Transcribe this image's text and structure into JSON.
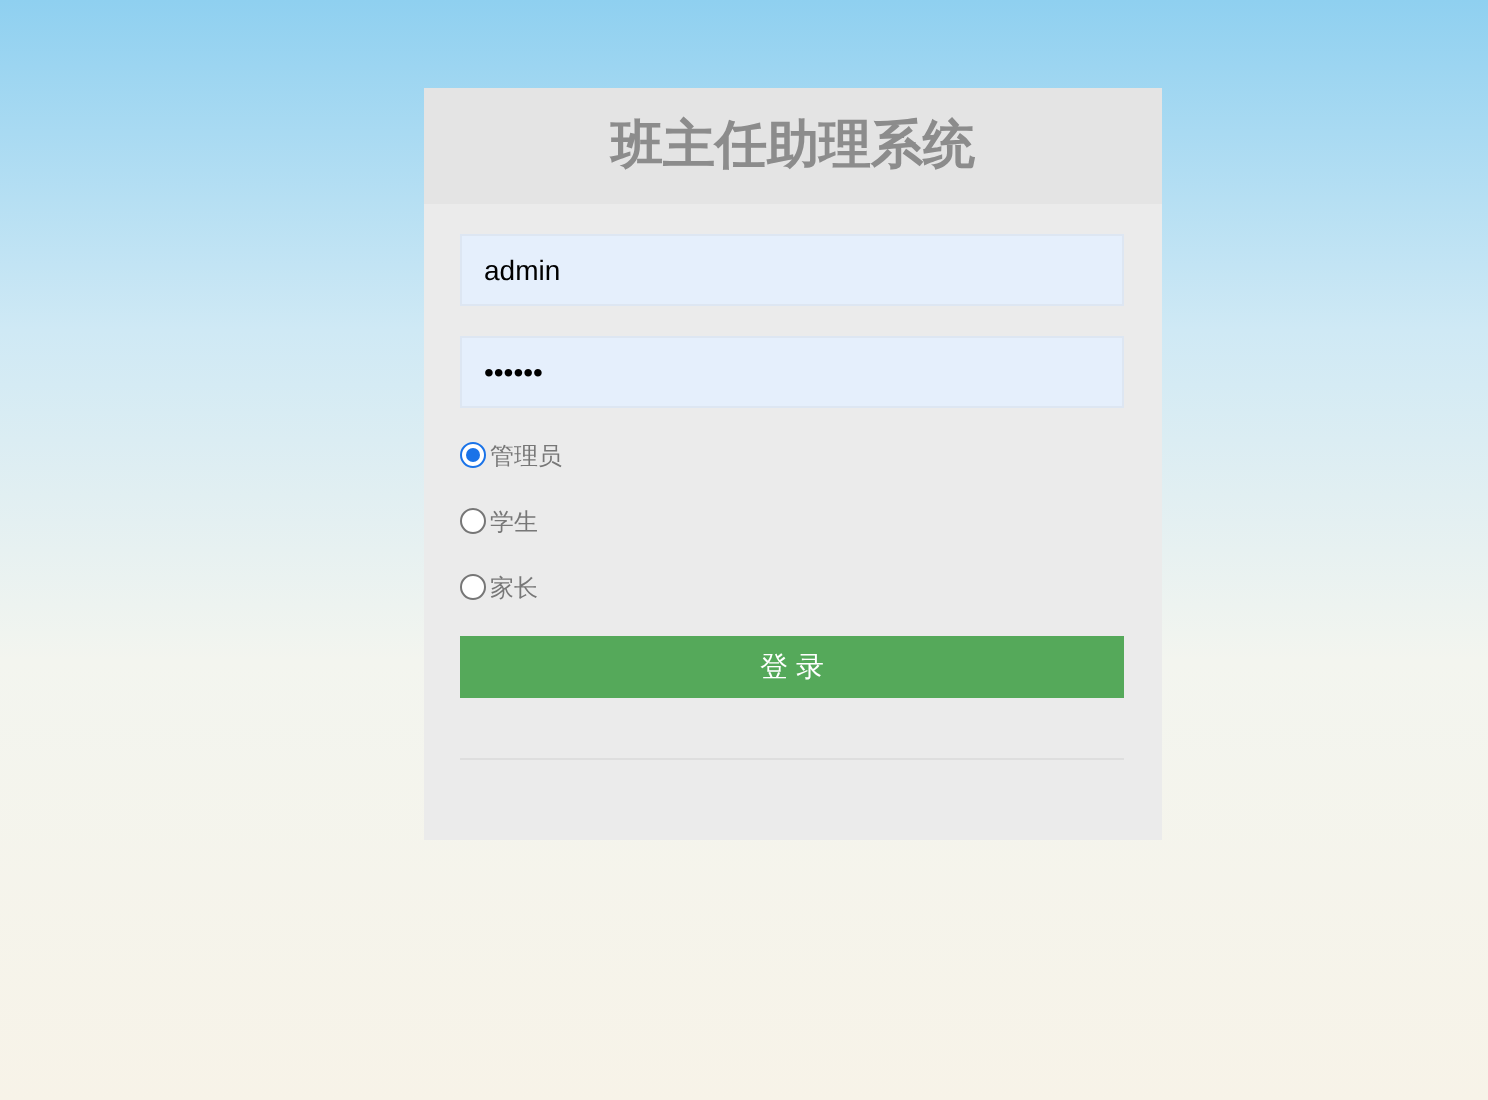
{
  "title": "班主任助理系统",
  "form": {
    "username": "admin",
    "password": "••••••",
    "roles": [
      {
        "label": "管理员",
        "selected": true
      },
      {
        "label": "学生",
        "selected": false
      },
      {
        "label": "家长",
        "selected": false
      }
    ],
    "submit": "登 录"
  }
}
